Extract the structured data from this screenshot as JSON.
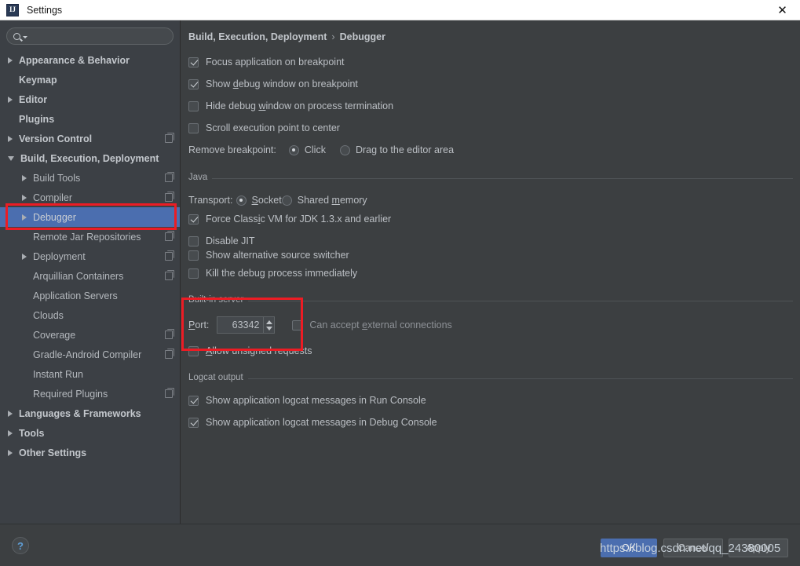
{
  "window": {
    "title": "Settings",
    "app_icon": "intellij-idea-icon",
    "close_label": "✕"
  },
  "sidebar": {
    "search": {
      "placeholder": "",
      "value": "",
      "icon": "search-icon"
    },
    "items": [
      {
        "label": "Appearance & Behavior",
        "arrow": "right",
        "indent": 0,
        "bold": true,
        "selected": false,
        "module_icon": false
      },
      {
        "label": "Keymap",
        "arrow": "none",
        "indent": 0,
        "bold": true,
        "selected": false,
        "module_icon": false
      },
      {
        "label": "Editor",
        "arrow": "right",
        "indent": 0,
        "bold": true,
        "selected": false,
        "module_icon": false
      },
      {
        "label": "Plugins",
        "arrow": "none",
        "indent": 0,
        "bold": true,
        "selected": false,
        "module_icon": false
      },
      {
        "label": "Version Control",
        "arrow": "right",
        "indent": 0,
        "bold": true,
        "selected": false,
        "module_icon": true
      },
      {
        "label": "Build, Execution, Deployment",
        "arrow": "down",
        "indent": 0,
        "bold": true,
        "selected": false,
        "module_icon": false
      },
      {
        "label": "Build Tools",
        "arrow": "right",
        "indent": 1,
        "bold": false,
        "selected": false,
        "module_icon": true
      },
      {
        "label": "Compiler",
        "arrow": "right",
        "indent": 1,
        "bold": false,
        "selected": false,
        "module_icon": true
      },
      {
        "label": "Debugger",
        "arrow": "right",
        "indent": 1,
        "bold": false,
        "selected": true,
        "module_icon": false
      },
      {
        "label": "Remote Jar Repositories",
        "arrow": "none",
        "indent": 1,
        "bold": false,
        "selected": false,
        "module_icon": true
      },
      {
        "label": "Deployment",
        "arrow": "right",
        "indent": 1,
        "bold": false,
        "selected": false,
        "module_icon": true
      },
      {
        "label": "Arquillian Containers",
        "arrow": "none",
        "indent": 1,
        "bold": false,
        "selected": false,
        "module_icon": true
      },
      {
        "label": "Application Servers",
        "arrow": "none",
        "indent": 1,
        "bold": false,
        "selected": false,
        "module_icon": false
      },
      {
        "label": "Clouds",
        "arrow": "none",
        "indent": 1,
        "bold": false,
        "selected": false,
        "module_icon": false
      },
      {
        "label": "Coverage",
        "arrow": "none",
        "indent": 1,
        "bold": false,
        "selected": false,
        "module_icon": true
      },
      {
        "label": "Gradle-Android Compiler",
        "arrow": "none",
        "indent": 1,
        "bold": false,
        "selected": false,
        "module_icon": true
      },
      {
        "label": "Instant Run",
        "arrow": "none",
        "indent": 1,
        "bold": false,
        "selected": false,
        "module_icon": false
      },
      {
        "label": "Required Plugins",
        "arrow": "none",
        "indent": 1,
        "bold": false,
        "selected": false,
        "module_icon": true
      },
      {
        "label": "Languages & Frameworks",
        "arrow": "right",
        "indent": 0,
        "bold": true,
        "selected": false,
        "module_icon": false
      },
      {
        "label": "Tools",
        "arrow": "right",
        "indent": 0,
        "bold": true,
        "selected": false,
        "module_icon": false
      },
      {
        "label": "Other Settings",
        "arrow": "right",
        "indent": 0,
        "bold": true,
        "selected": false,
        "module_icon": false
      }
    ]
  },
  "content": {
    "breadcrumb": {
      "parent": "Build, Execution, Deployment",
      "separator": "›",
      "current": "Debugger"
    },
    "general_options": [
      {
        "label": "Focus application on breakpoint",
        "checked": true
      },
      {
        "label": "Show debug window on breakpoint",
        "checked": true
      },
      {
        "label": "Hide debug window on process termination",
        "checked": false
      },
      {
        "label": "Scroll execution point to center",
        "checked": false
      }
    ],
    "remove_breakpoint": {
      "label": "Remove breakpoint:",
      "options": [
        {
          "label": "Click",
          "selected": true
        },
        {
          "label": "Drag to the editor area",
          "selected": false
        }
      ]
    },
    "java_section": {
      "title": "Java",
      "transport_label": "Transport:",
      "transport_options": [
        {
          "label": "Socket",
          "selected": true
        },
        {
          "label": "Shared memory",
          "selected": false
        }
      ],
      "options": [
        {
          "label": "Force Classic VM for JDK 1.3.x and earlier",
          "checked": true
        },
        {
          "label": "Disable JIT",
          "checked": false
        },
        {
          "label": "Show alternative source switcher",
          "checked": false
        },
        {
          "label": "Kill the debug process immediately",
          "checked": false
        }
      ]
    },
    "builtin_server_section": {
      "title": "Built-in server",
      "port_label": "Port:",
      "port_value": "63342",
      "external_connections": {
        "label": "Can accept external connections",
        "checked": false
      },
      "allow_unsigned": {
        "label": "Allow unsigned requests",
        "checked": false
      }
    },
    "logcat_section": {
      "title": "Logcat output",
      "options": [
        {
          "label": "Show application logcat messages in Run Console",
          "checked": true
        },
        {
          "label": "Show application logcat messages in Debug Console",
          "checked": true
        }
      ]
    }
  },
  "footer": {
    "help_label": "?",
    "ok_label": "OK",
    "cancel_label": "Cancel",
    "apply_label": "Apply"
  },
  "overlay": {
    "watermark": "https://blog.csdn.net/qq_24380005",
    "annotation_color": "#ec1c24"
  },
  "colors": {
    "titlebar_bg": "#ffffff",
    "sidebar_bg": "#3c4045",
    "content_bg": "#3c3f41",
    "selection_blue": "#4b6eaf",
    "text": "#bbbfc4",
    "annotation_red": "#ec1c24"
  }
}
